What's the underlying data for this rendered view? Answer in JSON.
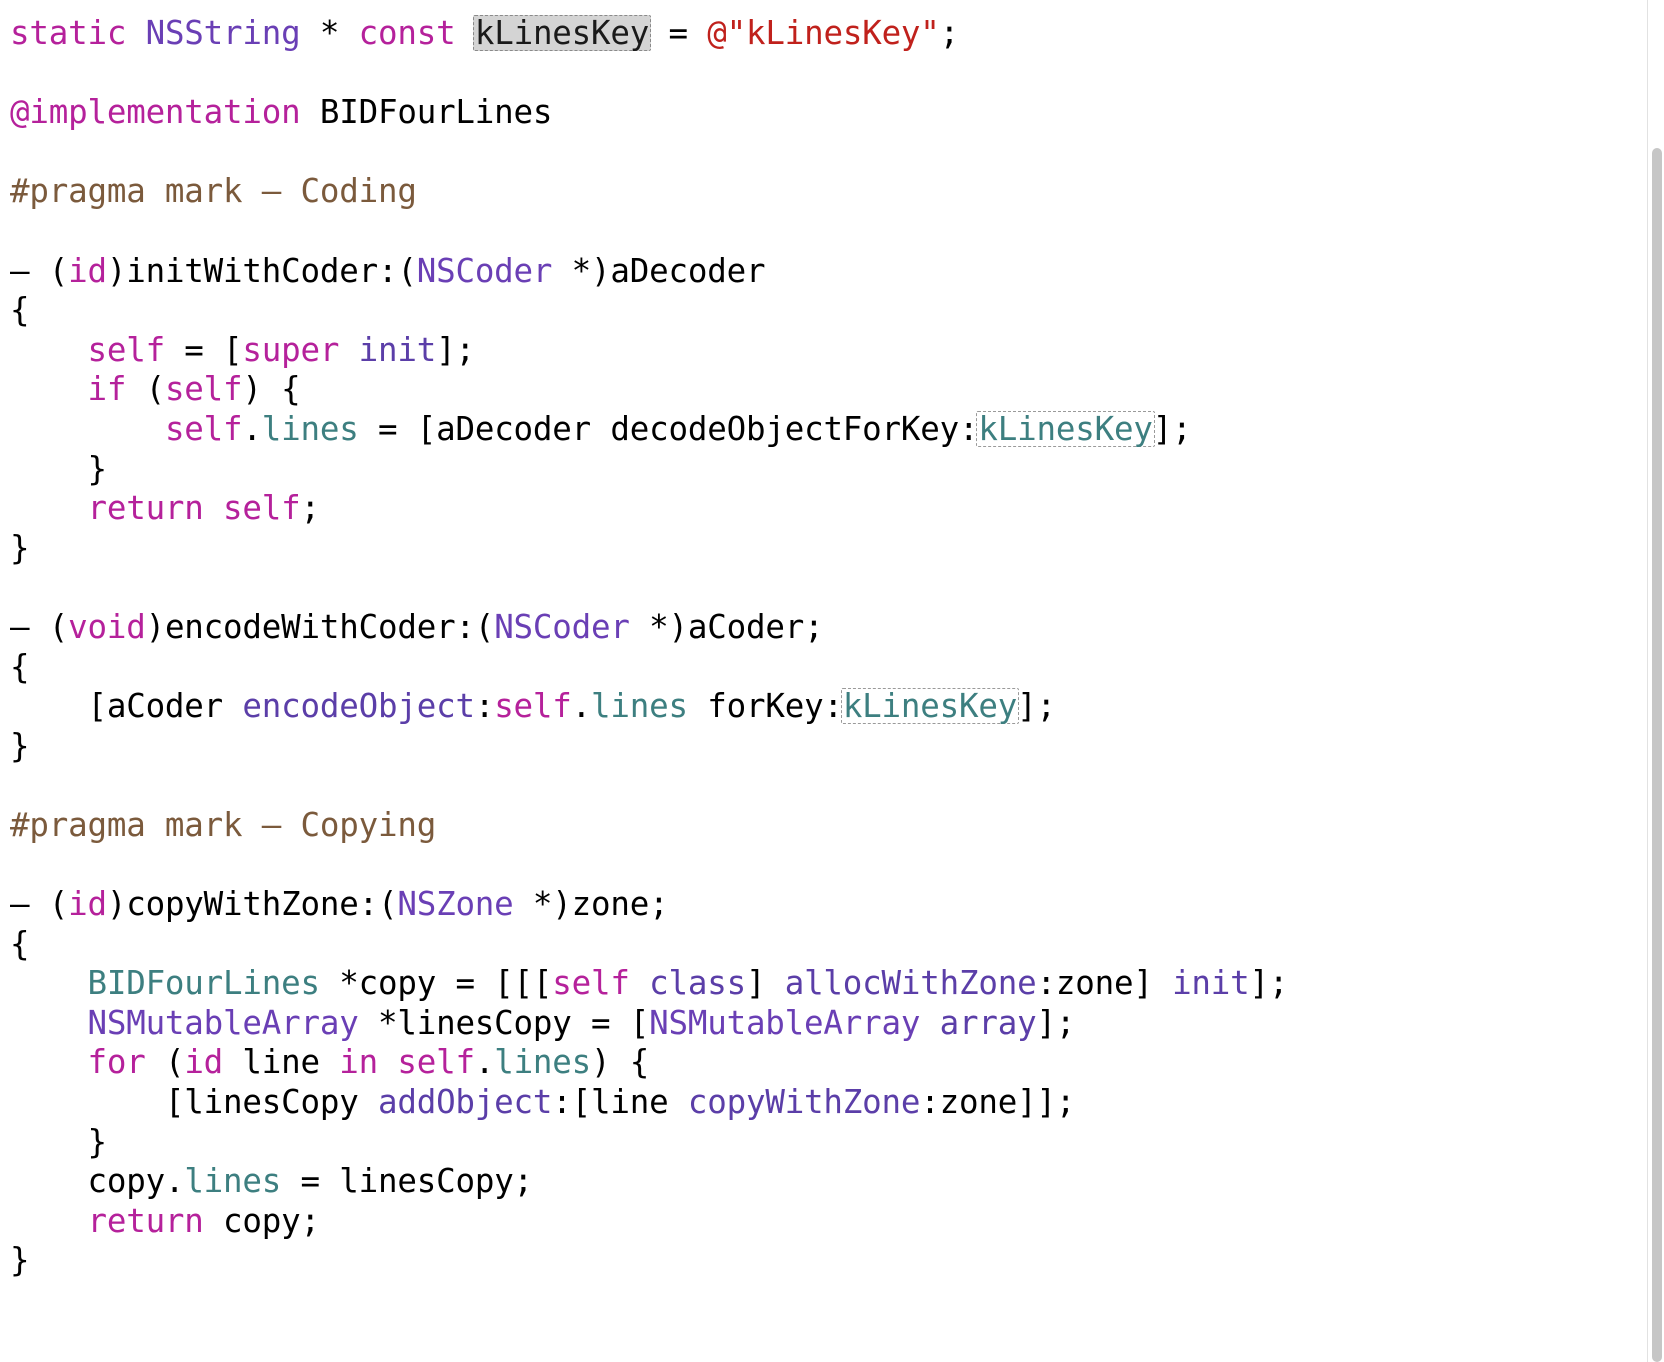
{
  "editor": {
    "language": "Objective-C",
    "file_symbol": "BIDFourLines",
    "background_color": "#ffffff",
    "colors": {
      "keyword": "#b5219b",
      "class_name": "#6a3fb5",
      "method_selector": "#5b3ea8",
      "string": "#c0211c",
      "comment_pragma": "#7b5a3c",
      "property": "#3d7f80",
      "plain_text": "#000000",
      "token_highlight_background": "#d4d4d4",
      "token_outline": "#9a9a9a",
      "scrollbar_thumb": "#c6c6c6"
    },
    "rename_token": "kLinesKey",
    "font_size_px": 32
  },
  "scrollbar": {
    "orientation": "vertical",
    "thumb_label": "scrollbar-thumb"
  },
  "code_lines": [
    {
      "index": 1,
      "segments": [
        {
          "t": "static",
          "c": "kw"
        },
        {
          "t": " ",
          "c": "pln"
        },
        {
          "t": "NSString",
          "c": "cls"
        },
        {
          "t": " * ",
          "c": "pln"
        },
        {
          "t": "const",
          "c": "kw"
        },
        {
          "t": " ",
          "c": "pln"
        },
        {
          "t": "kLinesKey",
          "c": "pln",
          "box": "active"
        },
        {
          "t": " = ",
          "c": "pln"
        },
        {
          "t": "@\"kLinesKey\"",
          "c": "str"
        },
        {
          "t": ";",
          "c": "pln"
        }
      ]
    },
    {
      "index": 2,
      "segments": []
    },
    {
      "index": 3,
      "segments": [
        {
          "t": "@implementation",
          "c": "pre"
        },
        {
          "t": " BIDFourLines",
          "c": "pln"
        }
      ]
    },
    {
      "index": 4,
      "segments": []
    },
    {
      "index": 5,
      "segments": [
        {
          "t": "#pragma mark – Coding",
          "c": "cmt"
        }
      ]
    },
    {
      "index": 6,
      "segments": []
    },
    {
      "index": 7,
      "segments": [
        {
          "t": "– (",
          "c": "pln"
        },
        {
          "t": "id",
          "c": "kw"
        },
        {
          "t": ")initWithCoder:(",
          "c": "pln"
        },
        {
          "t": "NSCoder",
          "c": "cls"
        },
        {
          "t": " *)aDecoder",
          "c": "pln"
        }
      ]
    },
    {
      "index": 8,
      "segments": [
        {
          "t": "{",
          "c": "pln"
        }
      ]
    },
    {
      "index": 9,
      "segments": [
        {
          "t": "    ",
          "c": "pln"
        },
        {
          "t": "self",
          "c": "kw"
        },
        {
          "t": " = [",
          "c": "pln"
        },
        {
          "t": "super",
          "c": "kw"
        },
        {
          "t": " ",
          "c": "pln"
        },
        {
          "t": "init",
          "c": "msg"
        },
        {
          "t": "];",
          "c": "pln"
        }
      ]
    },
    {
      "index": 10,
      "segments": [
        {
          "t": "    ",
          "c": "pln"
        },
        {
          "t": "if",
          "c": "kw"
        },
        {
          "t": " (",
          "c": "pln"
        },
        {
          "t": "self",
          "c": "kw"
        },
        {
          "t": ") {",
          "c": "pln"
        }
      ]
    },
    {
      "index": 11,
      "segments": [
        {
          "t": "        ",
          "c": "pln"
        },
        {
          "t": "self",
          "c": "kw"
        },
        {
          "t": ".",
          "c": "pln"
        },
        {
          "t": "lines",
          "c": "prop"
        },
        {
          "t": " = [aDecoder ",
          "c": "pln"
        },
        {
          "t": "decodeObjectForKey",
          "c": "pln"
        },
        {
          "t": ":",
          "c": "pln"
        },
        {
          "t": "kLinesKey",
          "c": "prop",
          "box": "outline"
        },
        {
          "t": "];",
          "c": "pln"
        }
      ]
    },
    {
      "index": 12,
      "segments": [
        {
          "t": "    }",
          "c": "pln"
        }
      ]
    },
    {
      "index": 13,
      "segments": [
        {
          "t": "    ",
          "c": "pln"
        },
        {
          "t": "return",
          "c": "kw"
        },
        {
          "t": " ",
          "c": "pln"
        },
        {
          "t": "self",
          "c": "kw"
        },
        {
          "t": ";",
          "c": "pln"
        }
      ]
    },
    {
      "index": 14,
      "segments": [
        {
          "t": "}",
          "c": "pln"
        }
      ]
    },
    {
      "index": 15,
      "segments": []
    },
    {
      "index": 16,
      "segments": [
        {
          "t": "– (",
          "c": "pln"
        },
        {
          "t": "void",
          "c": "kw"
        },
        {
          "t": ")encodeWithCoder:(",
          "c": "pln"
        },
        {
          "t": "NSCoder",
          "c": "cls"
        },
        {
          "t": " *)aCoder;",
          "c": "pln"
        }
      ]
    },
    {
      "index": 17,
      "segments": [
        {
          "t": "{",
          "c": "pln"
        }
      ]
    },
    {
      "index": 18,
      "segments": [
        {
          "t": "    [aCoder ",
          "c": "pln"
        },
        {
          "t": "encodeObject",
          "c": "msg"
        },
        {
          "t": ":",
          "c": "pln"
        },
        {
          "t": "self",
          "c": "kw"
        },
        {
          "t": ".",
          "c": "pln"
        },
        {
          "t": "lines",
          "c": "prop"
        },
        {
          "t": " forKey:",
          "c": "pln"
        },
        {
          "t": "kLinesKey",
          "c": "prop",
          "box": "outline"
        },
        {
          "t": "];",
          "c": "pln"
        }
      ]
    },
    {
      "index": 19,
      "segments": [
        {
          "t": "}",
          "c": "pln"
        }
      ]
    },
    {
      "index": 20,
      "segments": []
    },
    {
      "index": 21,
      "segments": [
        {
          "t": "#pragma mark – Copying",
          "c": "cmt"
        }
      ]
    },
    {
      "index": 22,
      "segments": []
    },
    {
      "index": 23,
      "segments": [
        {
          "t": "– (",
          "c": "pln"
        },
        {
          "t": "id",
          "c": "kw"
        },
        {
          "t": ")copyWithZone:(",
          "c": "pln"
        },
        {
          "t": "NSZone",
          "c": "cls"
        },
        {
          "t": " *)zone;",
          "c": "pln"
        }
      ]
    },
    {
      "index": 24,
      "segments": [
        {
          "t": "{",
          "c": "pln"
        }
      ]
    },
    {
      "index": 25,
      "segments": [
        {
          "t": "    ",
          "c": "pln"
        },
        {
          "t": "BIDFourLines",
          "c": "prop"
        },
        {
          "t": " *copy = [[[",
          "c": "pln"
        },
        {
          "t": "self",
          "c": "kw"
        },
        {
          "t": " ",
          "c": "pln"
        },
        {
          "t": "class",
          "c": "msg"
        },
        {
          "t": "] ",
          "c": "pln"
        },
        {
          "t": "allocWithZone",
          "c": "msg"
        },
        {
          "t": ":zone] ",
          "c": "pln"
        },
        {
          "t": "init",
          "c": "msg"
        },
        {
          "t": "];",
          "c": "pln"
        }
      ]
    },
    {
      "index": 26,
      "segments": [
        {
          "t": "    ",
          "c": "pln"
        },
        {
          "t": "NSMutableArray",
          "c": "cls"
        },
        {
          "t": " *linesCopy = [",
          "c": "pln"
        },
        {
          "t": "NSMutableArray",
          "c": "cls"
        },
        {
          "t": " ",
          "c": "pln"
        },
        {
          "t": "array",
          "c": "msg"
        },
        {
          "t": "];",
          "c": "pln"
        }
      ]
    },
    {
      "index": 27,
      "segments": [
        {
          "t": "    ",
          "c": "pln"
        },
        {
          "t": "for",
          "c": "kw"
        },
        {
          "t": " (",
          "c": "pln"
        },
        {
          "t": "id",
          "c": "kw"
        },
        {
          "t": " line ",
          "c": "pln"
        },
        {
          "t": "in",
          "c": "kw"
        },
        {
          "t": " ",
          "c": "pln"
        },
        {
          "t": "self",
          "c": "kw"
        },
        {
          "t": ".",
          "c": "pln"
        },
        {
          "t": "lines",
          "c": "prop"
        },
        {
          "t": ") {",
          "c": "pln"
        }
      ]
    },
    {
      "index": 28,
      "segments": [
        {
          "t": "        [linesCopy ",
          "c": "pln"
        },
        {
          "t": "addObject",
          "c": "msg"
        },
        {
          "t": ":[line ",
          "c": "pln"
        },
        {
          "t": "copyWithZone",
          "c": "msg"
        },
        {
          "t": ":zone]];",
          "c": "pln"
        }
      ]
    },
    {
      "index": 29,
      "segments": [
        {
          "t": "    }",
          "c": "pln"
        }
      ]
    },
    {
      "index": 30,
      "segments": [
        {
          "t": "    copy.",
          "c": "pln"
        },
        {
          "t": "lines",
          "c": "prop"
        },
        {
          "t": " = linesCopy;",
          "c": "pln"
        }
      ]
    },
    {
      "index": 31,
      "segments": [
        {
          "t": "    ",
          "c": "pln"
        },
        {
          "t": "return",
          "c": "kw"
        },
        {
          "t": " copy;",
          "c": "pln"
        }
      ]
    },
    {
      "index": 32,
      "segments": [
        {
          "t": "}",
          "c": "pln"
        }
      ]
    }
  ]
}
